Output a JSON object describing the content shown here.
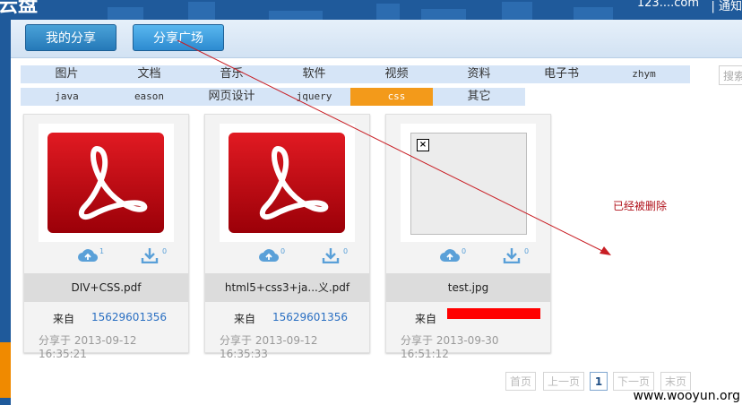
{
  "header": {
    "logo": "云盘",
    "user": "123....com",
    "notice": "| 通知"
  },
  "tabs": [
    "我的分享",
    "分享广场"
  ],
  "categories_row1": [
    "图片",
    "文档",
    "音乐",
    "软件",
    "视频",
    "资料",
    "电子书",
    "zhym"
  ],
  "categories_row2": [
    "java",
    "eason",
    "网页设计",
    "jquery",
    "css",
    "其它"
  ],
  "search_placeholder": "搜索",
  "cards": [
    {
      "title": "DIV+CSS.pdf",
      "from_label": "来自",
      "from_user": "15629601356",
      "time": "分享于 2013-09-12 16:35:21",
      "save_count": "1",
      "download_count": "0"
    },
    {
      "title": "html5+css3+ja...义.pdf",
      "from_label": "来自",
      "from_user": "15629601356",
      "time": "分享于 2013-09-12 16:35:33",
      "save_count": "0",
      "download_count": "0"
    },
    {
      "title": "test.jpg",
      "from_label": "来自",
      "from_user": "",
      "time": "分享于 2013-09-30 16:51:12",
      "save_count": "0",
      "download_count": "0"
    }
  ],
  "annotation": "已经被删除",
  "pager": {
    "first": "首页",
    "prev": "上一页",
    "current": "1",
    "next": "下一页",
    "last": "末页"
  },
  "watermark": "www.wooyun.org",
  "colors": {
    "active_category": "#f39a1a",
    "header_blue": "#1f5a9b",
    "annotation_red": "#b0121b"
  }
}
